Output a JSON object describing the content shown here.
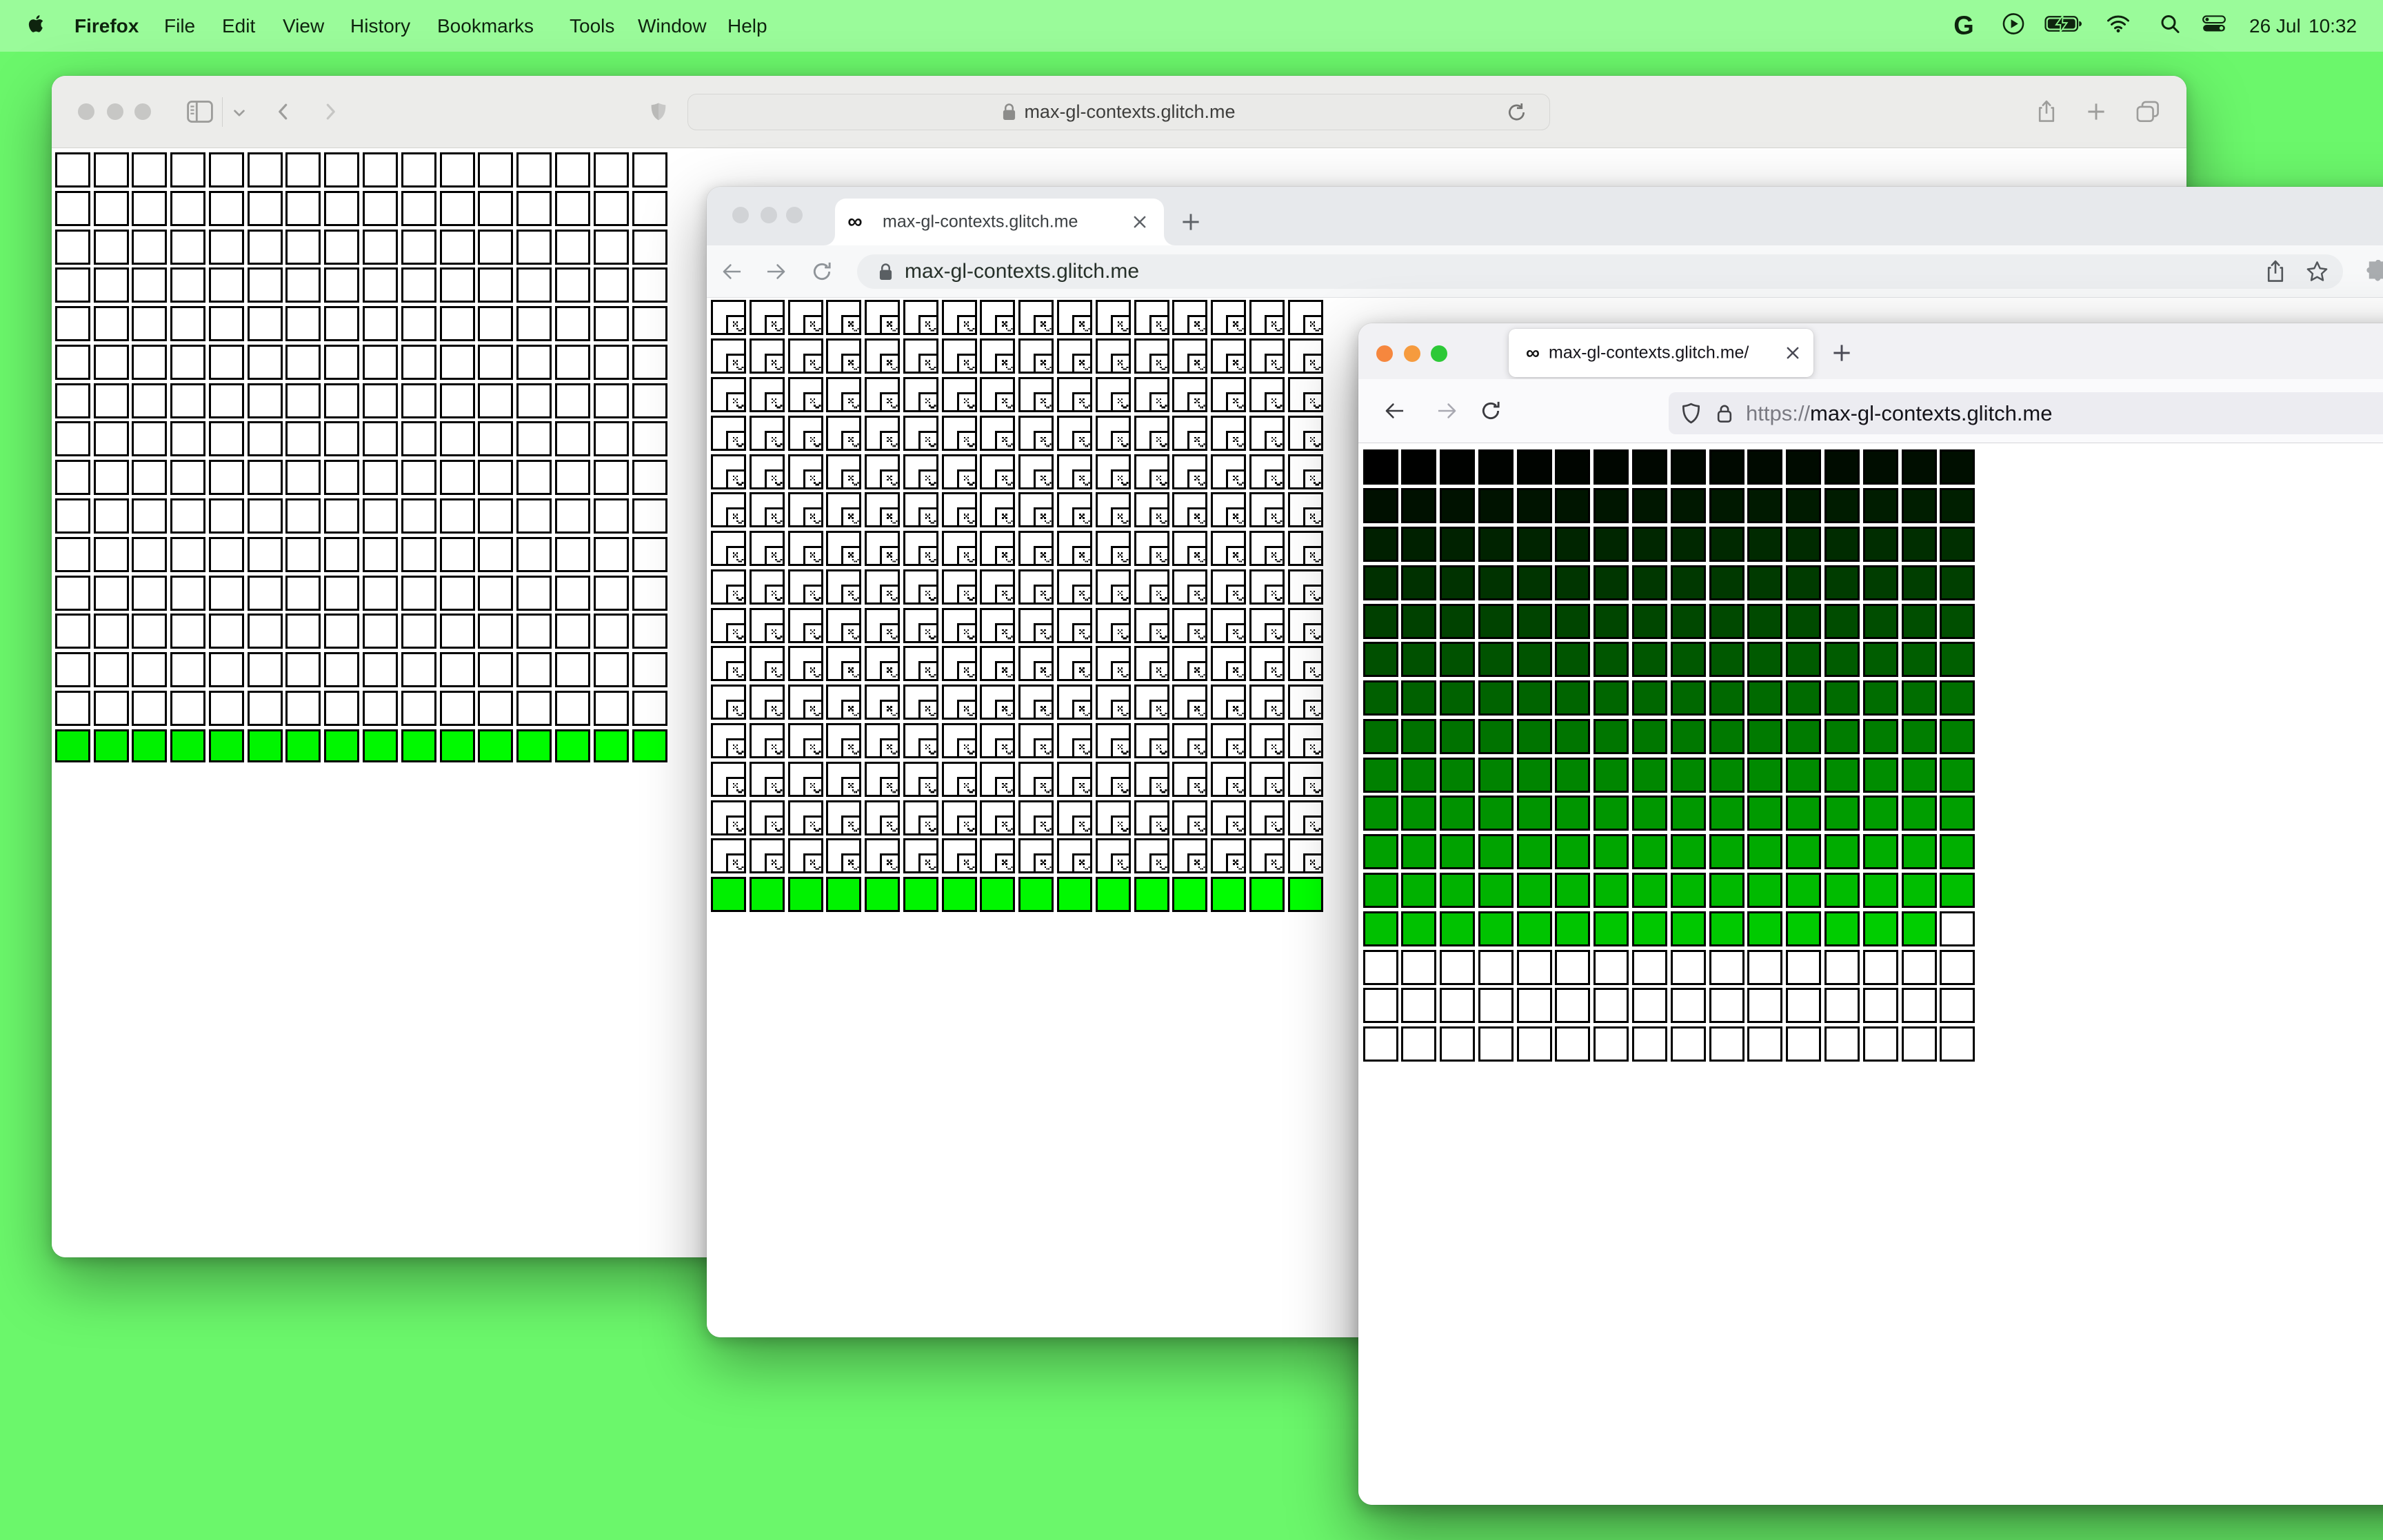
{
  "desktop": {
    "wallpaper_color": "#6bf76b",
    "menubar_color": "#9afb9a"
  },
  "menu_bar": {
    "apple_icon": "apple-logo",
    "app_name": "Firefox",
    "menus": [
      "File",
      "Edit",
      "View",
      "History",
      "Bookmarks",
      "Tools",
      "Window",
      "Help"
    ],
    "status_icons": [
      "google-g",
      "play-circle",
      "battery-charging",
      "wifi",
      "search",
      "control-center"
    ],
    "google_g_label": "G",
    "status_date": "26 Jul",
    "status_time": "10:32"
  },
  "safari_window": {
    "browser": "Safari",
    "focused": false,
    "url": "max-gl-contexts.glitch.me",
    "toolbar_icons": [
      "sidebar",
      "chevron-down",
      "back",
      "forward",
      "shield",
      "lock",
      "reload",
      "share",
      "new-tab",
      "tab-overview"
    ],
    "grid": {
      "cols": 16,
      "rows": 16,
      "lost_context_cells": 240,
      "live_context_cells": 16,
      "live_color_rule": "rgb(0, 240+i, 0)",
      "cells": [
        "empty",
        "empty",
        "empty",
        "empty",
        "empty",
        "empty",
        "empty",
        "empty",
        "empty",
        "empty",
        "empty",
        "empty",
        "empty",
        "empty",
        "empty",
        "empty",
        "empty",
        "empty",
        "empty",
        "empty",
        "empty",
        "empty",
        "empty",
        "empty",
        "empty",
        "empty",
        "empty",
        "empty",
        "empty",
        "empty",
        "empty",
        "empty",
        "empty",
        "empty",
        "empty",
        "empty",
        "empty",
        "empty",
        "empty",
        "empty",
        "empty",
        "empty",
        "empty",
        "empty",
        "empty",
        "empty",
        "empty",
        "empty",
        "empty",
        "empty",
        "empty",
        "empty",
        "empty",
        "empty",
        "empty",
        "empty",
        "empty",
        "empty",
        "empty",
        "empty",
        "empty",
        "empty",
        "empty",
        "empty",
        "empty",
        "empty",
        "empty",
        "empty",
        "empty",
        "empty",
        "empty",
        "empty",
        "empty",
        "empty",
        "empty",
        "empty",
        "empty",
        "empty",
        "empty",
        "empty",
        "empty",
        "empty",
        "empty",
        "empty",
        "empty",
        "empty",
        "empty",
        "empty",
        "empty",
        "empty",
        "empty",
        "empty",
        "empty",
        "empty",
        "empty",
        "empty",
        "empty",
        "empty",
        "empty",
        "empty",
        "empty",
        "empty",
        "empty",
        "empty",
        "empty",
        "empty",
        "empty",
        "empty",
        "empty",
        "empty",
        "empty",
        "empty",
        "empty",
        "empty",
        "empty",
        "empty",
        "empty",
        "empty",
        "empty",
        "empty",
        "empty",
        "empty",
        "empty",
        "empty",
        "empty",
        "empty",
        "empty",
        "empty",
        "empty",
        "empty",
        "empty",
        "empty",
        "empty",
        "empty",
        "empty",
        "empty",
        "empty",
        "empty",
        "empty",
        "empty",
        "empty",
        "empty",
        "empty",
        "empty",
        "empty",
        "empty",
        "empty",
        "empty",
        "empty",
        "empty",
        "empty",
        "empty",
        "empty",
        "empty",
        "empty",
        "empty",
        "empty",
        "empty",
        "empty",
        "empty",
        "empty",
        "empty",
        "empty",
        "empty",
        "empty",
        "empty",
        "empty",
        "empty",
        "empty",
        "empty",
        "empty",
        "empty",
        "empty",
        "empty",
        "empty",
        "empty",
        "empty",
        "empty",
        "empty",
        "empty",
        "empty",
        "empty",
        "empty",
        "empty",
        "empty",
        "empty",
        "empty",
        "empty",
        "empty",
        "empty",
        "empty",
        "empty",
        "empty",
        "empty",
        "empty",
        "empty",
        "empty",
        "empty",
        "empty",
        "empty",
        "empty",
        "empty",
        "empty",
        "empty",
        "empty",
        "empty",
        "empty",
        "empty",
        "empty",
        "empty",
        "empty",
        "empty",
        "empty",
        "empty",
        "empty",
        "empty",
        "empty",
        "empty",
        "empty",
        "empty",
        "empty",
        "empty",
        "empty",
        "empty",
        "empty",
        "empty",
        "empty",
        "empty",
        "empty",
        "empty",
        "empty",
        "empty",
        "empty",
        "empty",
        "empty",
        "empty",
        "empty",
        "empty",
        "empty",
        "empty",
        "#00F000",
        "#00F100",
        "#00F200",
        "#00F300",
        "#00F400",
        "#00F500",
        "#00F600",
        "#00F700",
        "#00F800",
        "#00F900",
        "#00FA00",
        "#00FB00",
        "#00FC00",
        "#00FD00",
        "#00FE00",
        "#00FF00"
      ]
    }
  },
  "chrome_window": {
    "browser": "Chrome",
    "focused": false,
    "tab_favicon": "∞",
    "tab_title": "max-gl-contexts.glitch.me",
    "url": "max-gl-contexts.glitch.me",
    "toolbar_icons": [
      "back",
      "forward",
      "reload",
      "lock",
      "share",
      "bookmark-star",
      "extensions-puzzle"
    ],
    "grid": {
      "cols": 16,
      "rows": 16,
      "sad_canvas_cells": 240,
      "live_context_cells": 16,
      "live_color_rule": "rgb(0, 240+i, 0)",
      "cells": [
        "sad",
        "sad",
        "sad",
        "sad",
        "sad",
        "sad",
        "sad",
        "sad",
        "sad",
        "sad",
        "sad",
        "sad",
        "sad",
        "sad",
        "sad",
        "sad",
        "sad",
        "sad",
        "sad",
        "sad",
        "sad",
        "sad",
        "sad",
        "sad",
        "sad",
        "sad",
        "sad",
        "sad",
        "sad",
        "sad",
        "sad",
        "sad",
        "sad",
        "sad",
        "sad",
        "sad",
        "sad",
        "sad",
        "sad",
        "sad",
        "sad",
        "sad",
        "sad",
        "sad",
        "sad",
        "sad",
        "sad",
        "sad",
        "sad",
        "sad",
        "sad",
        "sad",
        "sad",
        "sad",
        "sad",
        "sad",
        "sad",
        "sad",
        "sad",
        "sad",
        "sad",
        "sad",
        "sad",
        "sad",
        "sad",
        "sad",
        "sad",
        "sad",
        "sad",
        "sad",
        "sad",
        "sad",
        "sad",
        "sad",
        "sad",
        "sad",
        "sad",
        "sad",
        "sad",
        "sad",
        "sad",
        "sad",
        "sad",
        "sad",
        "sad",
        "sad",
        "sad",
        "sad",
        "sad",
        "sad",
        "sad",
        "sad",
        "sad",
        "sad",
        "sad",
        "sad",
        "sad",
        "sad",
        "sad",
        "sad",
        "sad",
        "sad",
        "sad",
        "sad",
        "sad",
        "sad",
        "sad",
        "sad",
        "sad",
        "sad",
        "sad",
        "sad",
        "sad",
        "sad",
        "sad",
        "sad",
        "sad",
        "sad",
        "sad",
        "sad",
        "sad",
        "sad",
        "sad",
        "sad",
        "sad",
        "sad",
        "sad",
        "sad",
        "sad",
        "sad",
        "sad",
        "sad",
        "sad",
        "sad",
        "sad",
        "sad",
        "sad",
        "sad",
        "sad",
        "sad",
        "sad",
        "sad",
        "sad",
        "sad",
        "sad",
        "sad",
        "sad",
        "sad",
        "sad",
        "sad",
        "sad",
        "sad",
        "sad",
        "sad",
        "sad",
        "sad",
        "sad",
        "sad",
        "sad",
        "sad",
        "sad",
        "sad",
        "sad",
        "sad",
        "sad",
        "sad",
        "sad",
        "sad",
        "sad",
        "sad",
        "sad",
        "sad",
        "sad",
        "sad",
        "sad",
        "sad",
        "sad",
        "sad",
        "sad",
        "sad",
        "sad",
        "sad",
        "sad",
        "sad",
        "sad",
        "sad",
        "sad",
        "sad",
        "sad",
        "sad",
        "sad",
        "sad",
        "sad",
        "sad",
        "sad",
        "sad",
        "sad",
        "sad",
        "sad",
        "sad",
        "sad",
        "sad",
        "sad",
        "sad",
        "sad",
        "sad",
        "sad",
        "sad",
        "sad",
        "sad",
        "sad",
        "sad",
        "sad",
        "sad",
        "sad",
        "sad",
        "sad",
        "sad",
        "sad",
        "sad",
        "sad",
        "sad",
        "sad",
        "sad",
        "sad",
        "sad",
        "sad",
        "sad",
        "sad",
        "sad",
        "sad",
        "sad",
        "sad",
        "sad",
        "sad",
        "sad",
        "sad",
        "sad",
        "sad",
        "sad",
        "#00F000",
        "#00F100",
        "#00F200",
        "#00F300",
        "#00F400",
        "#00F500",
        "#00F600",
        "#00F700",
        "#00F800",
        "#00F900",
        "#00FA00",
        "#00FB00",
        "#00FC00",
        "#00FD00",
        "#00FE00",
        "#00FF00"
      ]
    }
  },
  "firefox_window": {
    "browser": "Firefox",
    "focused": true,
    "tab_favicon": "∞",
    "tab_title": "max-gl-contexts.glitch.me/",
    "url_scheme": "https://",
    "url_domain": "max-gl-contexts.glitch.me",
    "toolbar_icons": [
      "back",
      "forward",
      "reload",
      "shield",
      "lock"
    ],
    "grid": {
      "cols": 16,
      "rows": 16,
      "gradient_cells": 207,
      "empty_cells": 49,
      "gradient_color_rule": "rgb(0, i, 0)",
      "cells": [
        "#000000",
        "#000100",
        "#000200",
        "#000300",
        "#000400",
        "#000500",
        "#000600",
        "#000700",
        "#000800",
        "#000900",
        "#000A00",
        "#000B00",
        "#000C00",
        "#000D00",
        "#000E00",
        "#000F00",
        "#001000",
        "#001100",
        "#001200",
        "#001300",
        "#001400",
        "#001500",
        "#001600",
        "#001700",
        "#001800",
        "#001900",
        "#001A00",
        "#001B00",
        "#001C00",
        "#001D00",
        "#001E00",
        "#001F00",
        "#002000",
        "#002100",
        "#002200",
        "#002300",
        "#002400",
        "#002500",
        "#002600",
        "#002700",
        "#002800",
        "#002900",
        "#002A00",
        "#002B00",
        "#002C00",
        "#002D00",
        "#002E00",
        "#002F00",
        "#003000",
        "#003100",
        "#003200",
        "#003300",
        "#003400",
        "#003500",
        "#003600",
        "#003700",
        "#003800",
        "#003900",
        "#003A00",
        "#003B00",
        "#003C00",
        "#003D00",
        "#003E00",
        "#003F00",
        "#004000",
        "#004100",
        "#004200",
        "#004300",
        "#004400",
        "#004500",
        "#004600",
        "#004700",
        "#004800",
        "#004900",
        "#004A00",
        "#004B00",
        "#004C00",
        "#004D00",
        "#004E00",
        "#004F00",
        "#005000",
        "#005100",
        "#005200",
        "#005300",
        "#005400",
        "#005500",
        "#005600",
        "#005700",
        "#005800",
        "#005900",
        "#005A00",
        "#005B00",
        "#005C00",
        "#005D00",
        "#005E00",
        "#005F00",
        "#006000",
        "#006100",
        "#006200",
        "#006300",
        "#006400",
        "#006500",
        "#006600",
        "#006700",
        "#006800",
        "#006900",
        "#006A00",
        "#006B00",
        "#006C00",
        "#006D00",
        "#006E00",
        "#006F00",
        "#007000",
        "#007100",
        "#007200",
        "#007300",
        "#007400",
        "#007500",
        "#007600",
        "#007700",
        "#007800",
        "#007900",
        "#007A00",
        "#007B00",
        "#007C00",
        "#007D00",
        "#007E00",
        "#007F00",
        "#008000",
        "#008100",
        "#008200",
        "#008300",
        "#008400",
        "#008500",
        "#008600",
        "#008700",
        "#008800",
        "#008900",
        "#008A00",
        "#008B00",
        "#008C00",
        "#008D00",
        "#008E00",
        "#008F00",
        "#009000",
        "#009100",
        "#009200",
        "#009300",
        "#009400",
        "#009500",
        "#009600",
        "#009700",
        "#009800",
        "#009900",
        "#009A00",
        "#009B00",
        "#009C00",
        "#009D00",
        "#009E00",
        "#009F00",
        "#00A000",
        "#00A100",
        "#00A200",
        "#00A300",
        "#00A400",
        "#00A500",
        "#00A600",
        "#00A700",
        "#00A800",
        "#00A900",
        "#00AA00",
        "#00AB00",
        "#00AC00",
        "#00AD00",
        "#00AE00",
        "#00AF00",
        "#00B000",
        "#00B100",
        "#00B200",
        "#00B300",
        "#00B400",
        "#00B500",
        "#00B600",
        "#00B700",
        "#00B800",
        "#00B900",
        "#00BA00",
        "#00BB00",
        "#00BC00",
        "#00BD00",
        "#00BE00",
        "#00BF00",
        "#00C000",
        "#00C100",
        "#00C200",
        "#00C300",
        "#00C400",
        "#00C500",
        "#00C600",
        "#00C700",
        "#00C800",
        "#00C900",
        "#00CA00",
        "#00CB00",
        "#00CC00",
        "#00CD00",
        "#00CE00",
        "empty",
        "empty",
        "empty",
        "empty",
        "empty",
        "empty",
        "empty",
        "empty",
        "empty",
        "empty",
        "empty",
        "empty",
        "empty",
        "empty",
        "empty",
        "empty",
        "empty",
        "empty",
        "empty",
        "empty",
        "empty",
        "empty",
        "empty",
        "empty",
        "empty",
        "empty",
        "empty",
        "empty",
        "empty",
        "empty",
        "empty",
        "empty",
        "empty",
        "empty",
        "empty",
        "empty",
        "empty",
        "empty",
        "empty",
        "empty",
        "empty",
        "empty",
        "empty",
        "empty",
        "empty",
        "empty",
        "empty",
        "empty",
        "empty"
      ]
    }
  }
}
